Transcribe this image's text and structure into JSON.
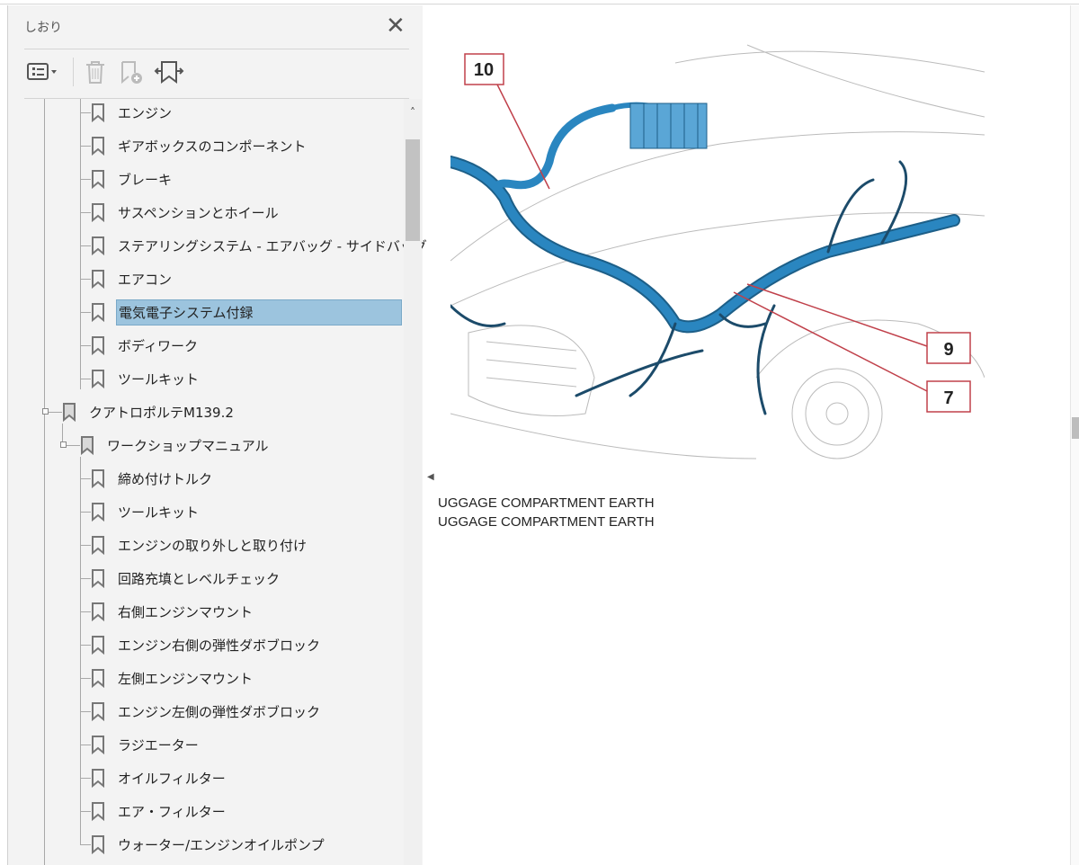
{
  "panel": {
    "title": "しおり",
    "close_icon": "close-icon"
  },
  "toolbar": {
    "options": "options-menu-icon",
    "delete": "trash-icon",
    "new": "new-bookmark-icon",
    "expand": "expand-bookmark-icon"
  },
  "bookmarks": [
    {
      "label": "エンジン",
      "level": 2
    },
    {
      "label": "ギアボックスのコンポーネント",
      "level": 2
    },
    {
      "label": "ブレーキ",
      "level": 2
    },
    {
      "label": "サスペンションとホイール",
      "level": 2
    },
    {
      "label": "ステアリングシステム - エアバッグ - サイドバッグ",
      "level": 2
    },
    {
      "label": "エアコン",
      "level": 2
    },
    {
      "label": "電気電子システム付録",
      "level": 2,
      "selected": true
    },
    {
      "label": "ボディワーク",
      "level": 2
    },
    {
      "label": "ツールキット",
      "level": 2
    },
    {
      "label": "クアトロポルテM139.2",
      "level": 0
    },
    {
      "label": "ワークショップマニュアル",
      "level": 1
    },
    {
      "label": "締め付けトルク",
      "level": 2
    },
    {
      "label": "ツールキット",
      "level": 2
    },
    {
      "label": "エンジンの取り外しと取り付け",
      "level": 2
    },
    {
      "label": "回路充填とレベルチェック",
      "level": 2
    },
    {
      "label": "右側エンジンマウント",
      "level": 2
    },
    {
      "label": "エンジン右側の弾性ダボブロック",
      "level": 2
    },
    {
      "label": "左側エンジンマウント",
      "level": 2
    },
    {
      "label": "エンジン左側の弾性ダボブロック",
      "level": 2
    },
    {
      "label": "ラジエーター",
      "level": 2
    },
    {
      "label": "オイルフィルター",
      "level": 2
    },
    {
      "label": "エア・フィルター",
      "level": 2
    },
    {
      "label": "ウォーター/エンジンオイルポンプ",
      "level": 2
    }
  ],
  "document": {
    "callouts": [
      "10",
      "9",
      "7"
    ],
    "captions": [
      "UGGAGE COMPARTMENT EARTH",
      "UGGAGE COMPARTMENT EARTH"
    ],
    "harness_color": "#2a86c0",
    "callout_color": "#c0404a"
  }
}
